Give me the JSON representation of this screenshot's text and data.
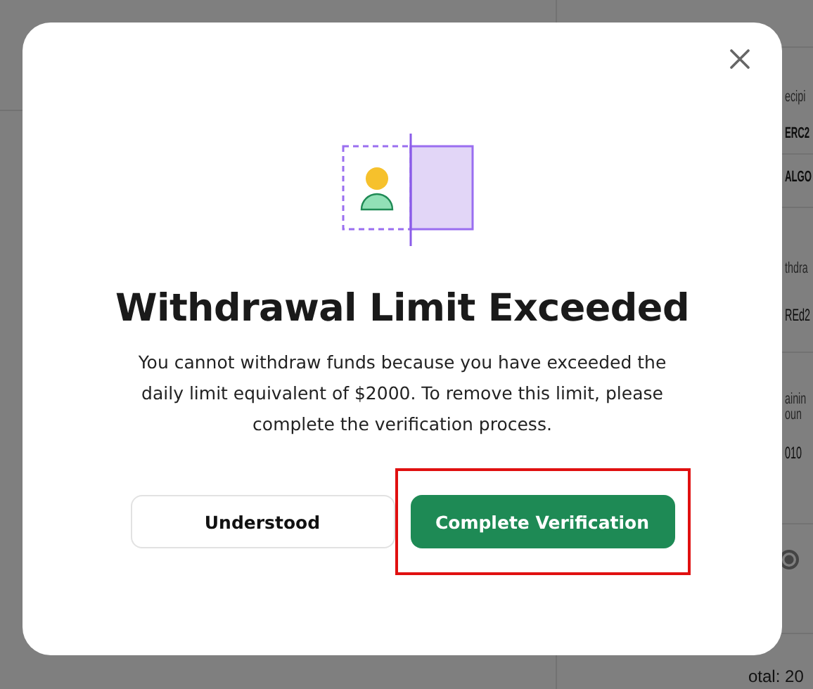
{
  "background_panel": {
    "rows": [
      {
        "kind": "label",
        "text": "ecipi"
      },
      {
        "kind": "value",
        "text": "ERC2"
      },
      {
        "kind": "value",
        "text": "ALGO"
      },
      {
        "kind": "label",
        "text": "thdra"
      },
      {
        "kind": "value",
        "text": "REd2"
      },
      {
        "kind": "label",
        "text": "ainin\noun"
      },
      {
        "kind": "value",
        "text": "010"
      },
      {
        "kind": "radio",
        "selected": true
      }
    ],
    "total": "otal: 20"
  },
  "modal": {
    "title": "Withdrawal Limit Exceeded",
    "message": "You cannot withdraw funds because you have exceeded the daily limit equivalent of $2000. To remove this limit, please complete the verification process.",
    "buttons": [
      {
        "label": "Understood",
        "kind": "secondary",
        "highlighted": false
      },
      {
        "label": "Complete Verification",
        "kind": "primary",
        "highlighted": true
      }
    ]
  }
}
